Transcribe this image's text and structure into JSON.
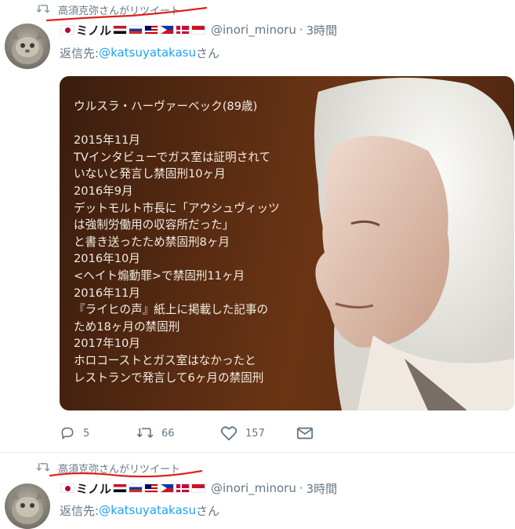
{
  "tweets": [
    {
      "retweeted_by": "高須克弥さんがリツイート",
      "display_name": "ミノル",
      "handle": "@inori_minoru",
      "time": "3時間",
      "reply_prefix": "返信先: ",
      "reply_to": "@katsuyatakasu",
      "reply_suffix": "さん",
      "image_text": "ウルスラ・ハーヴァーベック(89歳)\n\n2015年11月\nTVインタビューでガス室は証明されて\nいないと発言し禁固刑10ヶ月\n2016年9月\nデットモルト市長に「アウシュヴィッツ\nは強制労働用の収容所だった」\nと書き送ったため禁固刑8ヶ月\n2016年10月\n<ヘイト煽動罪>で禁固刑11ヶ月\n2016年11月\n『ライヒの声』紙上に掲載した記事の\nため18ヶ月の禁固刑\n2017年10月\nホロコーストとガス室はなかったと\nレストランで発言して6ヶ月の禁固刑",
      "reply_count": "5",
      "retweet_count": "66",
      "like_count": "157"
    },
    {
      "retweeted_by": "高須克弥さんがリツイート",
      "display_name": "ミノル",
      "handle": "@inori_minoru",
      "time": "3時間",
      "reply_prefix": "返信先: ",
      "reply_to": "@katsuyatakasu",
      "reply_suffix": "さん"
    }
  ],
  "icons": {
    "retweet": "retweet-icon",
    "reply": "reply-icon",
    "like": "heart-icon",
    "dm": "envelope-icon"
  },
  "colors": {
    "accent_link": "#1da1f2",
    "muted": "#657786",
    "annotation_red": "#e0201b"
  }
}
